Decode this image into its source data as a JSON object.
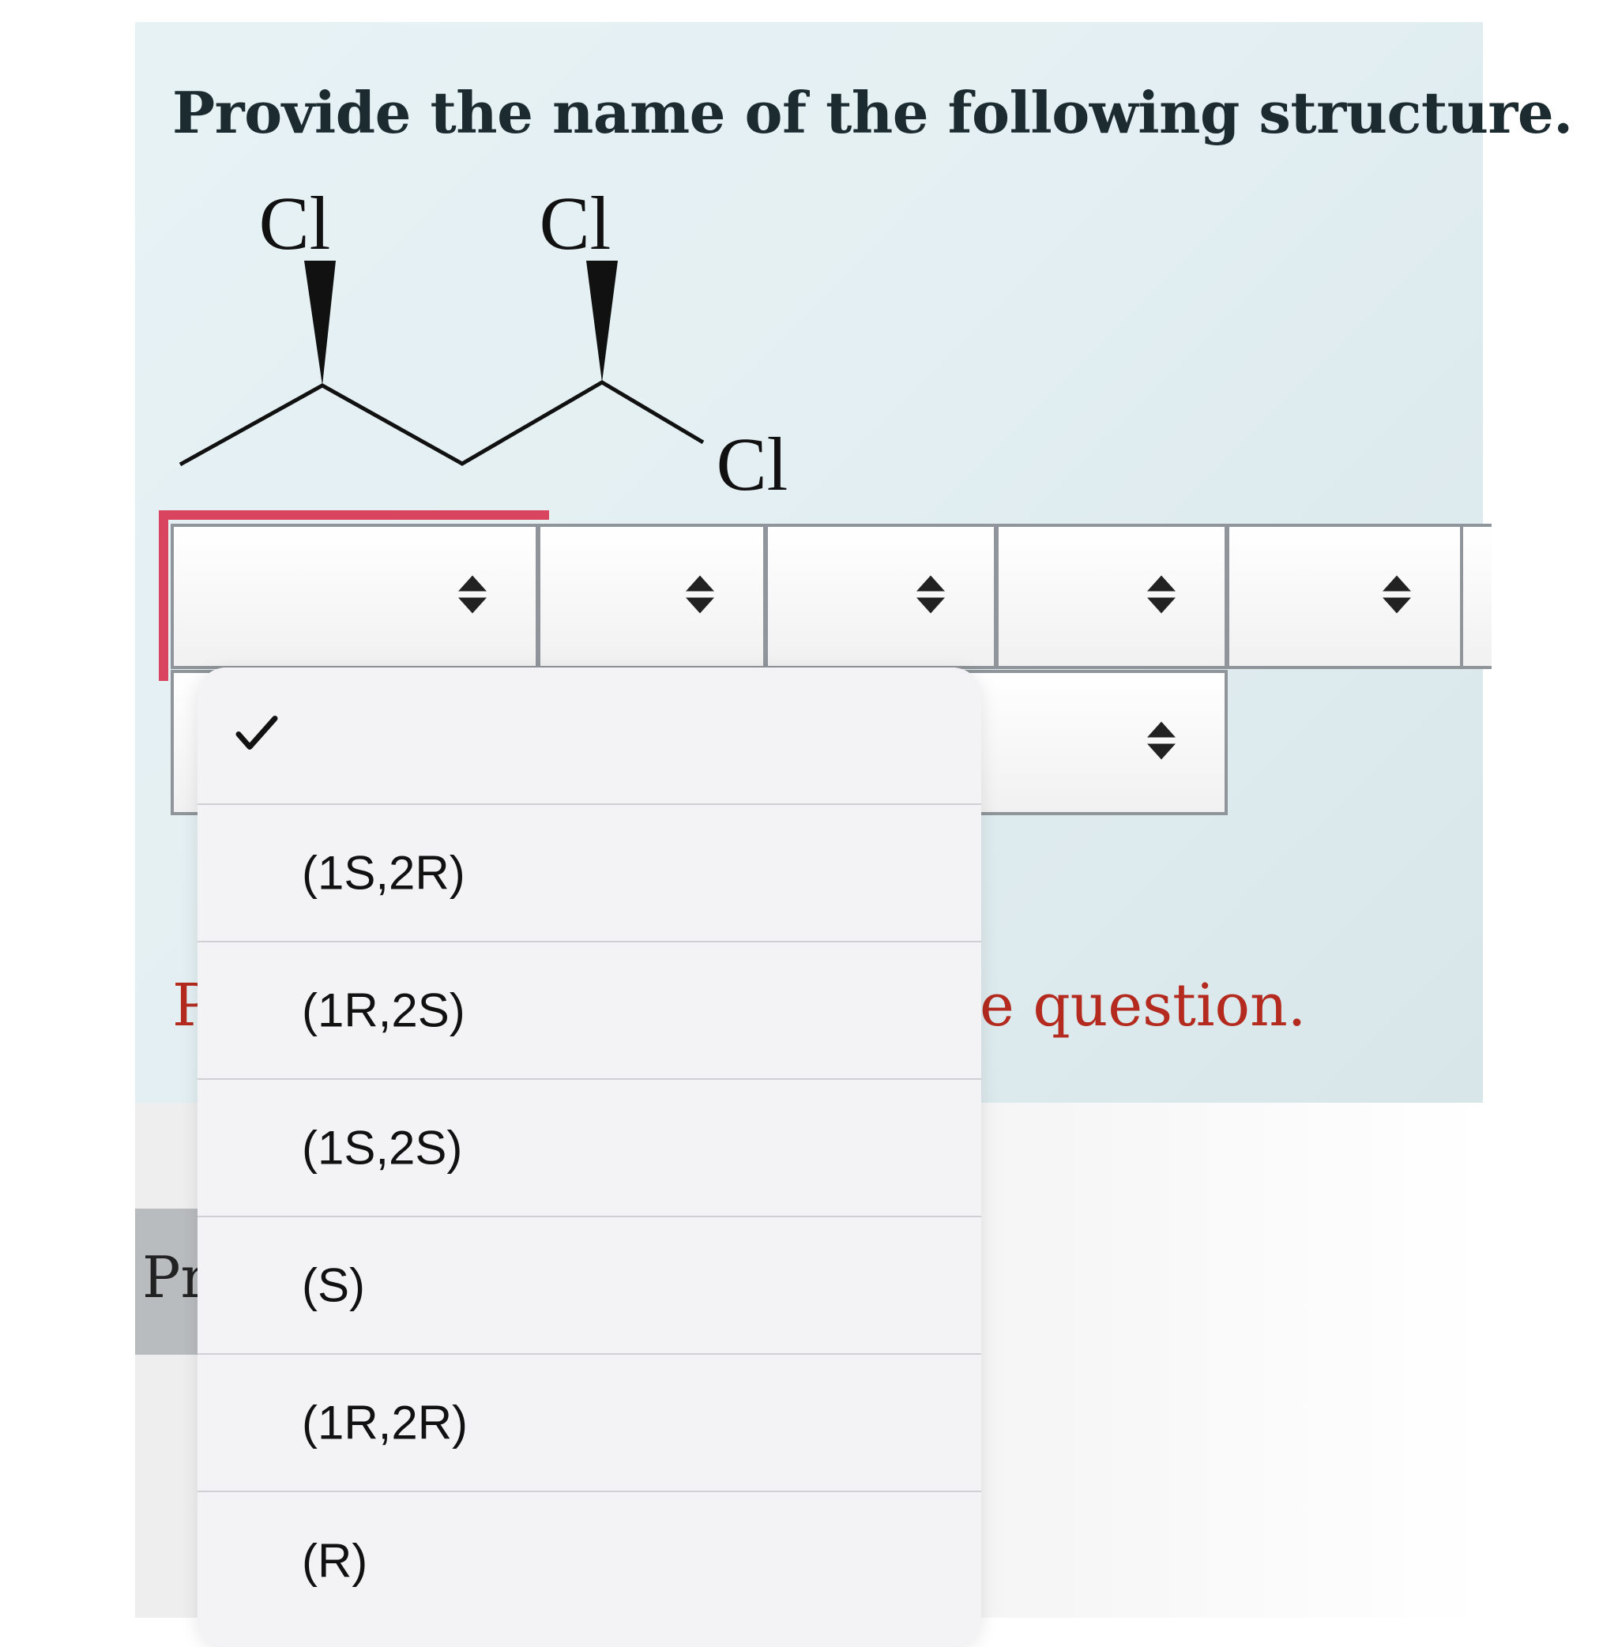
{
  "question": {
    "text": "Provide the name of the following structure."
  },
  "structure": {
    "atoms": [
      "Cl",
      "Cl",
      "Cl"
    ]
  },
  "selects": [
    {
      "selected": ""
    },
    {
      "selected": ""
    },
    {
      "selected": ""
    },
    {
      "selected": ""
    },
    {
      "selected": ""
    },
    {
      "selected": ""
    }
  ],
  "feedback": {
    "visible_left": "P",
    "visible_right": "e question."
  },
  "tab": {
    "label": "Pr"
  },
  "menu": {
    "options": [
      {
        "label": "",
        "checked": true
      },
      {
        "label": "(1S,2R)",
        "checked": false
      },
      {
        "label": "(1R,2S)",
        "checked": false
      },
      {
        "label": "(1S,2S)",
        "checked": false
      },
      {
        "label": "(S)",
        "checked": false
      },
      {
        "label": "(1R,2R)",
        "checked": false
      },
      {
        "label": "(R)",
        "checked": false
      }
    ]
  },
  "colors": {
    "focus": "#d9455f",
    "feedback": "#b42a1e",
    "panel": "#e6f2f4"
  }
}
